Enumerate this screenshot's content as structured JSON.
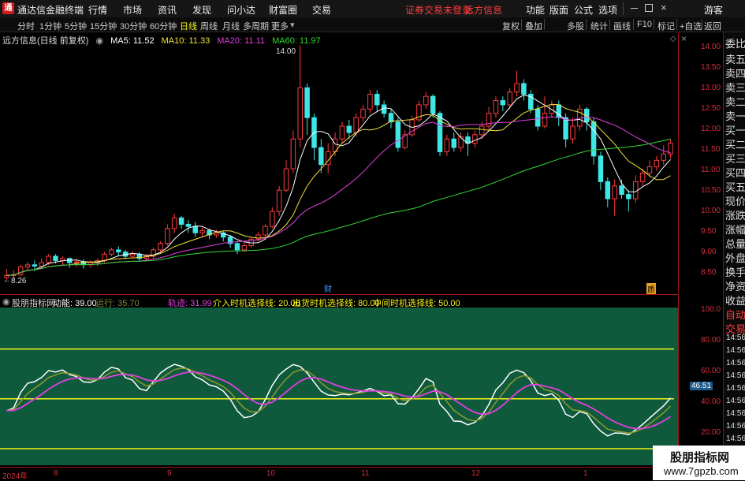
{
  "topbar": {
    "app_name": "通达信金融终端",
    "menus": [
      "行情",
      "市场",
      "资讯",
      "发现",
      "问小达",
      "财富圈",
      "交易"
    ],
    "warning": "证券交易未登录",
    "info": "远方信息",
    "right_items": [
      "功能",
      "版面",
      "公式",
      "选项"
    ],
    "guest": "游客"
  },
  "periodbar": {
    "periods": [
      "分时",
      "1分钟",
      "5分钟",
      "15分钟",
      "30分钟",
      "60分钟",
      "日线",
      "周线",
      "月线",
      "多周期",
      "更多"
    ],
    "active_period": "日线",
    "right_buttons": [
      "复权",
      "叠加",
      "多股",
      "统计",
      "画线",
      "F10",
      "标记",
      "+自选",
      "返回"
    ]
  },
  "main": {
    "stock_title": "远方信息(日线 前复权)",
    "ma": [
      {
        "label": "MA5: 11.52",
        "color": "#ffffff"
      },
      {
        "label": "MA10: 11.33",
        "color": "#f4e03a"
      },
      {
        "label": "MA20: 11.11",
        "color": "#e040e0"
      },
      {
        "label": "MA60: 11.97",
        "color": "#34d834"
      }
    ],
    "high_label": "14.00",
    "low_label": "8.26",
    "marker_cai": "财",
    "marker_zhi": "质"
  },
  "price_axis": [
    "14.00",
    "13.50",
    "13.00",
    "12.50",
    "12.00",
    "11.50",
    "11.00",
    "10.50",
    "10.00",
    "9.50",
    "9.00",
    "8.50"
  ],
  "indicator": {
    "name": "股朋指标网",
    "dynamic": "动能: 39.00",
    "running": "运行: 35.70",
    "track": "轨迹: 31.99",
    "entry": "介入时机选择线: 20.00",
    "exit": "出货时机选择线: 80.00",
    "mid": "中间时机选择线: 50.00",
    "axis": [
      "100.0",
      "80.00",
      "60.00",
      "40.00",
      "20.00"
    ],
    "current_value": "46.51",
    "lines": [
      80,
      50,
      20
    ],
    "bg_color": "#0f5a3c"
  },
  "right_panel": {
    "items": [
      "委比",
      "卖五",
      "卖四",
      "卖三",
      "卖二",
      "卖一",
      "买一",
      "买二",
      "买三",
      "买四",
      "买五",
      "现价",
      "涨跌",
      "涨幅",
      "总量",
      "外盘",
      "换手",
      "净资",
      "收益"
    ],
    "lower_items": [
      "自动",
      "交易"
    ],
    "times": [
      "14:56",
      "14:56",
      "14:56",
      "14:56",
      "14:56",
      "14:56",
      "14:56",
      "14:56",
      "14:56",
      "14:56"
    ]
  },
  "date_axis": [
    "2024年",
    "8",
    "9",
    "10",
    "11",
    "12",
    "1"
  ],
  "watermark": {
    "line1": "股朋指标网",
    "line2": "www.7gpzb.com"
  },
  "chart_data": {
    "type": "candlestick",
    "ylim": [
      8.2,
      14.3
    ],
    "candles": [
      [
        8.55,
        8.6,
        8.5,
        8.75
      ],
      [
        8.6,
        8.62,
        8.5,
        8.72
      ],
      [
        8.62,
        8.8,
        8.58,
        8.85
      ],
      [
        8.8,
        8.85,
        8.7,
        8.92
      ],
      [
        8.85,
        8.82,
        8.7,
        8.95
      ],
      [
        8.82,
        8.9,
        8.75,
        9.0
      ],
      [
        8.9,
        9.05,
        8.85,
        9.1
      ],
      [
        9.05,
        8.95,
        8.88,
        9.1
      ],
      [
        8.95,
        9.0,
        8.85,
        9.05
      ],
      [
        9.0,
        8.9,
        8.78,
        9.02
      ],
      [
        8.9,
        8.92,
        8.8,
        9.0
      ],
      [
        8.92,
        8.85,
        8.76,
        8.98
      ],
      [
        8.85,
        8.9,
        8.78,
        8.96
      ],
      [
        8.9,
        8.95,
        8.82,
        9.0
      ],
      [
        8.95,
        9.1,
        8.9,
        9.15
      ],
      [
        9.1,
        9.2,
        9.05,
        9.25
      ],
      [
        9.2,
        9.15,
        9.05,
        9.28
      ],
      [
        9.15,
        9.05,
        8.98,
        9.2
      ],
      [
        9.05,
        9.1,
        9.0,
        9.18
      ],
      [
        9.1,
        9.0,
        8.92,
        9.15
      ],
      [
        9.0,
        9.05,
        8.95,
        9.1
      ],
      [
        9.05,
        9.2,
        9.0,
        9.25
      ],
      [
        9.2,
        9.35,
        9.15,
        9.4
      ],
      [
        9.35,
        9.7,
        9.3,
        9.8
      ],
      [
        9.7,
        9.95,
        9.6,
        10.05
      ],
      [
        9.95,
        9.8,
        9.7,
        10.0
      ],
      [
        9.8,
        9.75,
        9.6,
        9.9
      ],
      [
        9.75,
        9.6,
        9.5,
        9.85
      ],
      [
        9.6,
        9.65,
        9.5,
        9.75
      ],
      [
        9.65,
        9.55,
        9.45,
        9.7
      ],
      [
        9.55,
        9.6,
        9.48,
        9.68
      ],
      [
        9.6,
        9.5,
        9.4,
        9.65
      ],
      [
        9.5,
        9.35,
        9.25,
        9.55
      ],
      [
        9.35,
        9.2,
        9.1,
        9.4
      ],
      [
        9.2,
        9.3,
        9.15,
        9.38
      ],
      [
        9.3,
        9.45,
        9.25,
        9.5
      ],
      [
        9.45,
        9.55,
        9.4,
        9.62
      ],
      [
        9.55,
        9.75,
        9.5,
        9.8
      ],
      [
        9.75,
        10.1,
        9.7,
        10.2
      ],
      [
        10.1,
        10.6,
        10.0,
        10.7
      ],
      [
        10.6,
        11.1,
        10.55,
        11.3
      ],
      [
        11.1,
        11.8,
        11.0,
        12.0
      ],
      [
        11.8,
        13.0,
        11.6,
        14.0
      ],
      [
        13.0,
        12.3,
        11.9,
        13.1
      ],
      [
        12.3,
        11.6,
        11.3,
        12.4
      ],
      [
        11.6,
        11.2,
        11.0,
        11.8
      ],
      [
        11.2,
        11.5,
        11.0,
        11.7
      ],
      [
        11.5,
        11.8,
        11.4,
        11.95
      ],
      [
        11.8,
        12.1,
        11.7,
        12.2
      ],
      [
        12.1,
        11.95,
        11.8,
        12.25
      ],
      [
        11.95,
        12.3,
        11.85,
        12.4
      ],
      [
        12.3,
        12.5,
        12.2,
        12.6
      ],
      [
        12.5,
        12.85,
        12.4,
        12.95
      ],
      [
        12.85,
        12.6,
        12.45,
        12.95
      ],
      [
        12.6,
        12.4,
        12.3,
        12.7
      ],
      [
        12.4,
        12.2,
        12.05,
        12.5
      ],
      [
        12.2,
        11.6,
        11.5,
        12.3
      ],
      [
        11.6,
        11.9,
        11.55,
        12.0
      ],
      [
        11.9,
        12.25,
        11.85,
        12.35
      ],
      [
        12.25,
        12.6,
        12.2,
        12.7
      ],
      [
        12.6,
        12.8,
        12.5,
        12.9
      ],
      [
        12.8,
        12.4,
        12.3,
        12.85
      ],
      [
        12.4,
        11.5,
        11.4,
        12.45
      ],
      [
        11.5,
        11.8,
        11.4,
        11.9
      ],
      [
        11.8,
        11.6,
        11.5,
        11.95
      ],
      [
        11.6,
        11.85,
        11.5,
        11.95
      ],
      [
        11.85,
        11.7,
        11.4,
        11.95
      ],
      [
        11.7,
        11.9,
        11.6,
        12.0
      ],
      [
        11.9,
        12.1,
        11.8,
        12.2
      ],
      [
        12.1,
        12.4,
        12.0,
        12.55
      ],
      [
        12.4,
        12.7,
        12.3,
        12.8
      ],
      [
        12.7,
        12.6,
        12.45,
        12.8
      ],
      [
        12.6,
        12.9,
        12.5,
        13.0
      ],
      [
        12.9,
        13.1,
        12.8,
        13.4
      ],
      [
        13.1,
        12.85,
        12.7,
        13.2
      ],
      [
        12.85,
        12.5,
        12.4,
        12.95
      ],
      [
        12.5,
        12.1,
        12.0,
        12.6
      ],
      [
        12.1,
        12.4,
        12.05,
        12.8
      ],
      [
        12.4,
        12.6,
        12.3,
        12.7
      ],
      [
        12.6,
        12.3,
        12.1,
        12.7
      ],
      [
        12.3,
        11.8,
        11.6,
        12.4
      ],
      [
        11.8,
        12.1,
        11.7,
        12.3
      ],
      [
        12.1,
        12.5,
        12.0,
        12.6
      ],
      [
        12.5,
        12.2,
        12.0,
        12.55
      ],
      [
        12.2,
        11.4,
        11.2,
        12.3
      ],
      [
        11.4,
        10.8,
        10.6,
        11.5
      ],
      [
        10.8,
        10.4,
        10.2,
        10.9
      ],
      [
        10.4,
        10.7,
        10.0,
        10.85
      ],
      [
        10.7,
        10.5,
        10.4,
        10.85
      ],
      [
        10.5,
        10.4,
        10.1,
        10.6
      ],
      [
        10.4,
        10.8,
        10.3,
        10.95
      ],
      [
        10.8,
        11.0,
        10.7,
        11.1
      ],
      [
        11.0,
        11.15,
        10.9,
        11.3
      ],
      [
        11.15,
        11.3,
        11.05,
        11.4
      ],
      [
        11.3,
        11.45,
        11.2,
        11.65
      ],
      [
        11.45,
        11.7,
        11.35,
        11.8
      ]
    ]
  }
}
